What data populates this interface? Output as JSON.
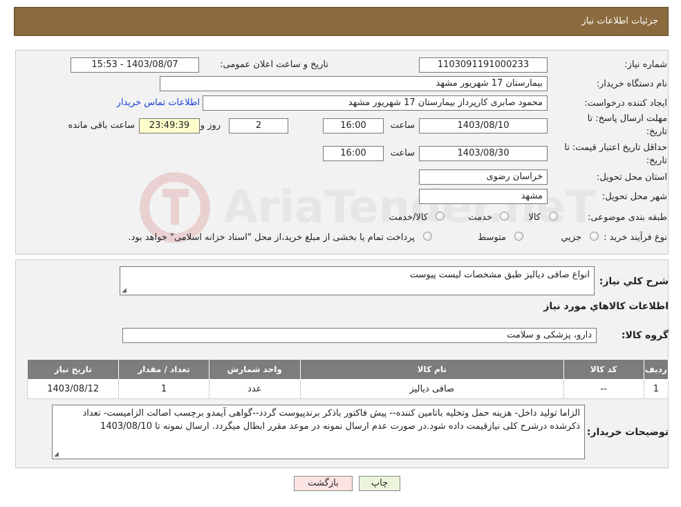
{
  "header": {
    "title": "جزئیات اطلاعات نیاز"
  },
  "watermark": {
    "text": "AriaTender.neT"
  },
  "form": {
    "need_number": {
      "label": "شماره نیاز:",
      "value": "1103091191000233"
    },
    "announce_datetime": {
      "label": "تاریخ و ساعت اعلان عمومی:",
      "value": "1403/08/07 - 15:53"
    },
    "buyer_org": {
      "label": "نام دستگاه خریدار:",
      "value": "بیمارستان 17 شهریور مشهد"
    },
    "requester": {
      "label": "ایجاد کننده درخواست:",
      "value": "محمود صابری کارپرداز بیمارستان 17 شهریور مشهد",
      "contact_link": "اطلاعات تماس خریدار"
    },
    "reply_deadline": {
      "label_line1": "مهلت ارسال پاسخ: تا",
      "label_line2": "تاریخ:",
      "date": "1403/08/10",
      "time_label": "ساعت",
      "time": "16:00",
      "days": "2",
      "days_label": "روز و",
      "remaining": "23:49:39",
      "remaining_label": "ساعت باقی مانده"
    },
    "price_validity": {
      "label_line1": "حداقل تاریخ اعتبار قیمت: تا",
      "label_line2": "تاریخ:",
      "date": "1403/08/30",
      "time_label": "ساعت",
      "time": "16:00"
    },
    "province": {
      "label": "استان محل تحویل:",
      "value": "خراسان رضوی"
    },
    "city": {
      "label": "شهر محل تحویل:",
      "value": "مشهد"
    },
    "category": {
      "label": "طبقه بندی موضوعی:",
      "options": [
        "کالا",
        "خدمت",
        "کالا/خدمت"
      ]
    },
    "process": {
      "label": "نوع فرآیند خرید :",
      "options": [
        "جزیي",
        "متوسط"
      ],
      "note": "پرداخت تمام یا بخشی از مبلغ خرید،از محل \"اسناد خزانه اسلامی\" خواهد بود."
    }
  },
  "summary": {
    "label": "شرح کلي نياز:",
    "value": "انواع صافی دیالیز طبق مشخصات لیست پیوست",
    "items_title": "اطلاعات کالاهاي مورد نياز",
    "group_label": "گروه کالا:",
    "group_value": "دارو، پزشکی و سلامت",
    "table": {
      "headers": [
        "رديف",
        "کد کالا",
        "نام کالا",
        "واحد شمارش",
        "تعداد / مقدار",
        "تاريخ نياز"
      ],
      "rows": [
        [
          "1",
          "--",
          "صافی دیالیز",
          "عدد",
          "1",
          "1403/08/12"
        ]
      ]
    },
    "buyer_notes_label": "توضیحات خریدار:",
    "buyer_notes": "الزاما تولید داخل- هزینه حمل وتخلیه باتامین کننده-- پیش فاکتور باذکر برندپیوست گردد--گواهی آیمدو برچسب اصالت الزامیست- تعداد ذکرشده درشرح کلی نیازقیمت داده شود.در صورت عدم ارسال نمونه در موعد مقرر ابطال میگردد. ارسال نمونه تا 1403/08/10"
  },
  "buttons": {
    "print": "چاپ",
    "back": "بازگشت"
  }
}
